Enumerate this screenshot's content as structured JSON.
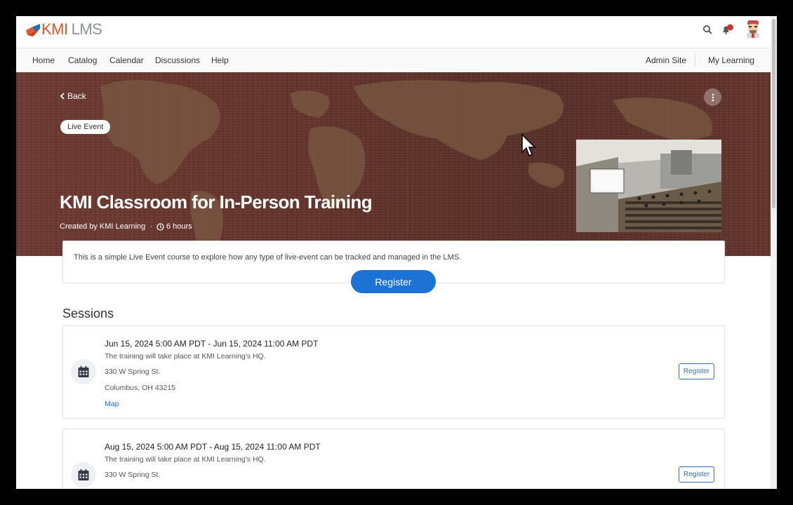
{
  "header": {
    "logo_kmi": "KMI",
    "logo_lms": "LMS"
  },
  "nav": {
    "items": [
      "Home",
      "Catalog",
      "Calendar",
      "Discussions",
      "Help"
    ],
    "right_items": [
      "Admin Site",
      "My Learning"
    ]
  },
  "hero": {
    "back_label": "Back",
    "badge": "Live Event",
    "title": "KMI Classroom for In-Person Training",
    "created_by": "Created by KMI Learning",
    "separator": "·",
    "duration": "6 hours"
  },
  "description": {
    "text": "This is a simple Live Event course to explore how any type of live-event can be tracked and managed in the LMS.",
    "register_label": "Register"
  },
  "sessions": {
    "heading": "Sessions",
    "items": [
      {
        "title": "Jun 15, 2024 5:00 AM PDT - Jun 15, 2024 11:00 AM PDT",
        "description": "The training will take place at KMI Learning's HQ.",
        "address1": "330 W Spring St.",
        "address2": "Columbus, OH 43215",
        "map_label": "Map",
        "register_label": "Register"
      },
      {
        "title": "Aug 15, 2024 5:00 AM PDT - Aug 15, 2024 11:00 AM PDT",
        "description": "The training will take place at KMI Learning's HQ.",
        "address1": "330 W Spring St.",
        "register_label": "Register"
      }
    ]
  },
  "colors": {
    "primary": "#1d72d6",
    "logo_orange": "#e2552e",
    "logo_gray": "#8c9199",
    "link": "#2b6cc4",
    "notification": "#d32f2f"
  }
}
